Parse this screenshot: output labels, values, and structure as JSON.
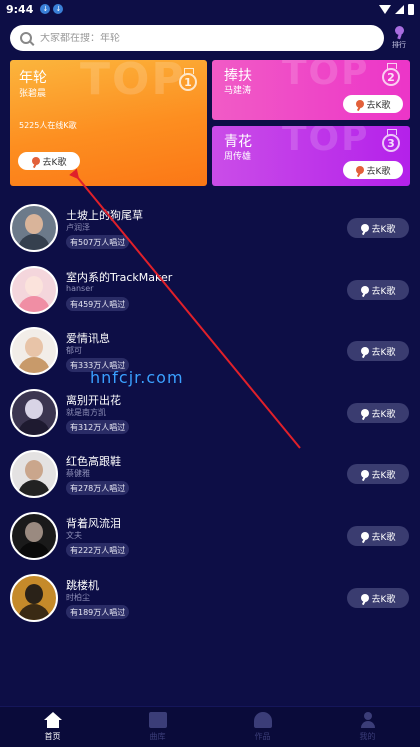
{
  "status_bar": {
    "time": "9:44"
  },
  "search": {
    "placeholder": "大家都在搜：年轮",
    "ranking_label": "排行"
  },
  "top_cards": [
    {
      "title": "年轮",
      "singer": "张碧晨",
      "online": "5225人在线K歌",
      "button": "去K歌",
      "rank": "1",
      "bg_word": "TOP"
    },
    {
      "title": "捧扶",
      "singer": "马建涛",
      "button": "去K歌",
      "rank": "2",
      "bg_word": "TOP"
    },
    {
      "title": "青花",
      "singer": "周传雄",
      "button": "去K歌",
      "rank": "3",
      "bg_word": "TOP"
    }
  ],
  "songs": [
    {
      "title": "土坡上的狗尾草",
      "singer": "卢润泽",
      "count": "有507万人唱过",
      "button": "去K歌"
    },
    {
      "title": "室内系的TrackMaker",
      "singer": "hanser",
      "count": "有459万人唱过",
      "button": "去K歌"
    },
    {
      "title": "爱情讯息",
      "singer": "郁可",
      "count": "有333万人唱过",
      "button": "去K歌"
    },
    {
      "title": "离别开出花",
      "singer": "就是南方凯",
      "count": "有312万人唱过",
      "button": "去K歌"
    },
    {
      "title": "红色高跟鞋",
      "singer": "蔡健雅",
      "count": "有278万人唱过",
      "button": "去K歌"
    },
    {
      "title": "背着风流泪",
      "singer": "文夫",
      "count": "有222万人唱过",
      "button": "去K歌"
    },
    {
      "title": "跳楼机",
      "singer": "时柏尘",
      "count": "有189万人唱过",
      "button": "去K歌"
    }
  ],
  "watermark": "hnfcjr.com",
  "tabs": [
    {
      "label": "首页",
      "icon": "home-icon"
    },
    {
      "label": "曲库",
      "icon": "library-icon"
    },
    {
      "label": "作品",
      "icon": "works-icon"
    },
    {
      "label": "我的",
      "icon": "profile-icon"
    }
  ],
  "colors": {
    "background": "#0d0e46",
    "card1": "#fd8e20",
    "card2": "#ec35c8",
    "card3": "#b421ea",
    "arrow": "#e0202a"
  }
}
